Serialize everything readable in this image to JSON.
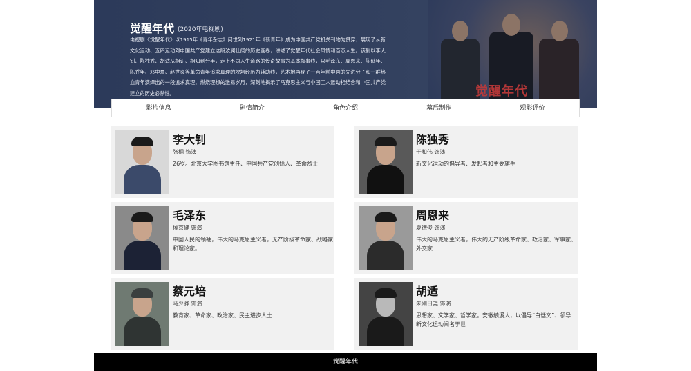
{
  "banner": {
    "title": "觉醒年代",
    "subtitle": "(2020年电视剧)",
    "description": "电视剧《觉醒年代》以1915年《青年杂志》问世到1921年《新青年》成为中国共产党机关刊物为贯穿，展现了从新文化运动、五四运动到中国共产党建立这段波澜壮阔的历史画卷，讲述了觉醒年代社会风情和百态人生。该剧以李大钊、陈独秀、胡适从相识、相知到分手，走上不同人生道路的传奇故事为基本叙事线，以毛泽东、周恩来、陈延年、陈乔年、邓中夏、赵世炎等革命青年追求真理的坎坷经历为辅助线，艺术地再现了一百年前中国的先进分子和一群热血青年演绎出的一段追求真理、燃烧理想的激昂岁月，深刻地揭示了马克思主义与中国工人运动相结合和中国共产党建立的历史必然性。",
    "poster_text": "觉醒年代"
  },
  "nav": {
    "items": [
      "影片信息",
      "剧情简介",
      "角色介绍",
      "幕后制作",
      "观影评价"
    ]
  },
  "cards": [
    {
      "name": "李大钊",
      "actor": "张桐 饰演",
      "desc": "26岁。北京大学图书馆主任、中国共产党创始人、革命烈士"
    },
    {
      "name": "陈独秀",
      "actor": "于和伟 饰演",
      "desc": "新文化运动的倡导者、发起者和主要旗手"
    },
    {
      "name": "毛泽东",
      "actor": "侯京健 饰演",
      "desc": "中国人民的领袖，伟大的马克思主义者，无产阶级革命家、战略家和理论家。"
    },
    {
      "name": "周恩来",
      "actor": "夏德俊 饰演",
      "desc": "伟大的马克思主义者，伟大的无产阶级革命家、政治家、军事家、外交家"
    },
    {
      "name": "蔡元培",
      "actor": "马少骅 饰演",
      "desc": "教育家、革命家、政治家、民主进步人士"
    },
    {
      "name": "胡适",
      "actor": "朱刚日尧 饰演",
      "desc": "思想家、文学家、哲学家。安徽绩溪人，以倡导“白话文”、领导新文化运动闻名于世"
    }
  ],
  "footer": {
    "text": "觉醒年代"
  }
}
